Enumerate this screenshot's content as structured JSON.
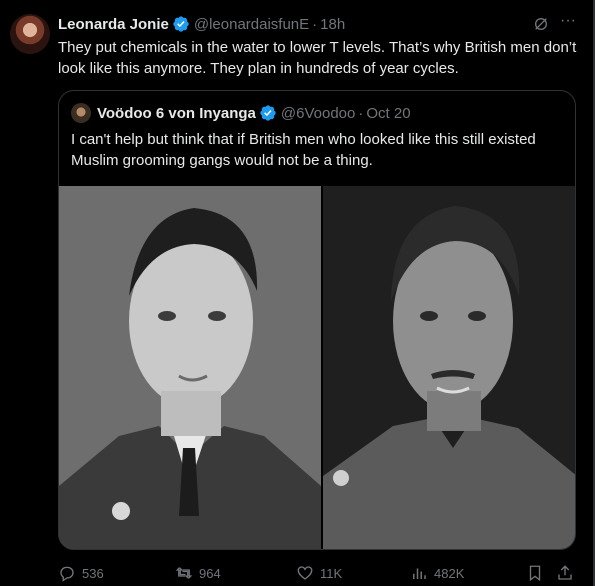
{
  "tweet": {
    "name": "Leonarda Jonie",
    "handle": "@leonardaisfunE",
    "time": "18h",
    "text": "They put chemicals in the water to lower T levels. That’s why British men don’t look like this anymore. They plan in hundreds of year cycles."
  },
  "quote": {
    "name": "Voödoo 6 von Inyanga",
    "handle": "@6Voodoo",
    "time": "Oct 20",
    "text": "I can't help but think that if British men who looked like this still existed Muslim grooming gangs would not be a thing."
  },
  "actions": {
    "replies": "536",
    "reposts": "964",
    "likes": "11K",
    "views": "482K"
  },
  "colors": {
    "background": "#000000",
    "text": "#e7e9ea",
    "muted": "#71767b",
    "verified": "#1d9bf0",
    "border": "#2f3336"
  }
}
